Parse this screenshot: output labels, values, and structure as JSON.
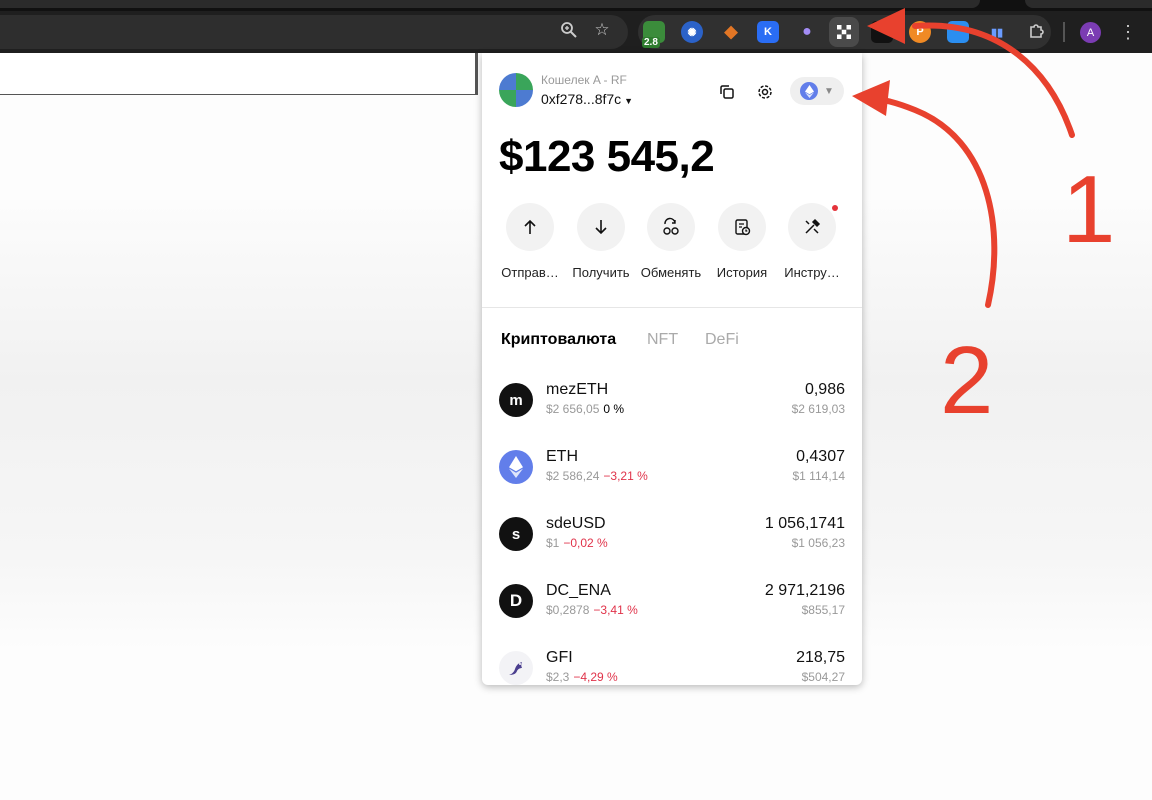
{
  "wallet": {
    "name": "Кошелек A - RF",
    "address": "0xf278...8f7c",
    "balance": "$123 545,2"
  },
  "actions": [
    {
      "label": "Отправ…",
      "icon": "arrow-up-icon"
    },
    {
      "label": "Получить",
      "icon": "arrow-down-icon"
    },
    {
      "label": "Обменять",
      "icon": "swap-icon"
    },
    {
      "label": "История",
      "icon": "history-icon"
    },
    {
      "label": "Инстру…",
      "icon": "tools-icon"
    }
  ],
  "tabs": [
    "Криптовалюта",
    "NFT",
    "DeFi"
  ],
  "tokens": [
    {
      "symbol": "mezETH",
      "icon_letter": "m",
      "price": "$2 656,05",
      "change": "0 %",
      "amount": "0,986",
      "usd": "$2 619,03"
    },
    {
      "symbol": "ETH",
      "icon_letter": "",
      "price": "$2 586,24",
      "change": "−3,21 %",
      "amount": "0,4307",
      "usd": "$1 114,14"
    },
    {
      "symbol": "sdeUSD",
      "icon_letter": "s",
      "price": "$1",
      "change": "−0,02 %",
      "amount": "1 056,1741",
      "usd": "$1 056,23"
    },
    {
      "symbol": "DC_ENA",
      "icon_letter": "D",
      "price": "$0,2878",
      "change": "−3,41 %",
      "amount": "2 971,2196",
      "usd": "$855,17"
    },
    {
      "symbol": "GFI",
      "icon_letter": "",
      "price": "$2,3",
      "change": "−4,29 %",
      "amount": "218,75",
      "usd": "$504,27"
    }
  ],
  "browser": {
    "extensions": [
      "green-extension-icon",
      "globe-extension-icon",
      "metamask-fox-icon",
      "k-extension-icon",
      "ghost-extension-icon",
      "okx-wallet-icon",
      "dark-extension-icon",
      "orange-p-extension-icon",
      "blue-extension-icon",
      "bars-extension-icon",
      "puzzle-extensions-icon"
    ],
    "badge": "2.8",
    "profile_letter": "A"
  },
  "annotations": {
    "label1": "1",
    "label2": "2",
    "color": "#e8412e"
  },
  "colors": {
    "negative": "#e0334a",
    "eth": "#627eea",
    "annotation": "#e8412e"
  }
}
